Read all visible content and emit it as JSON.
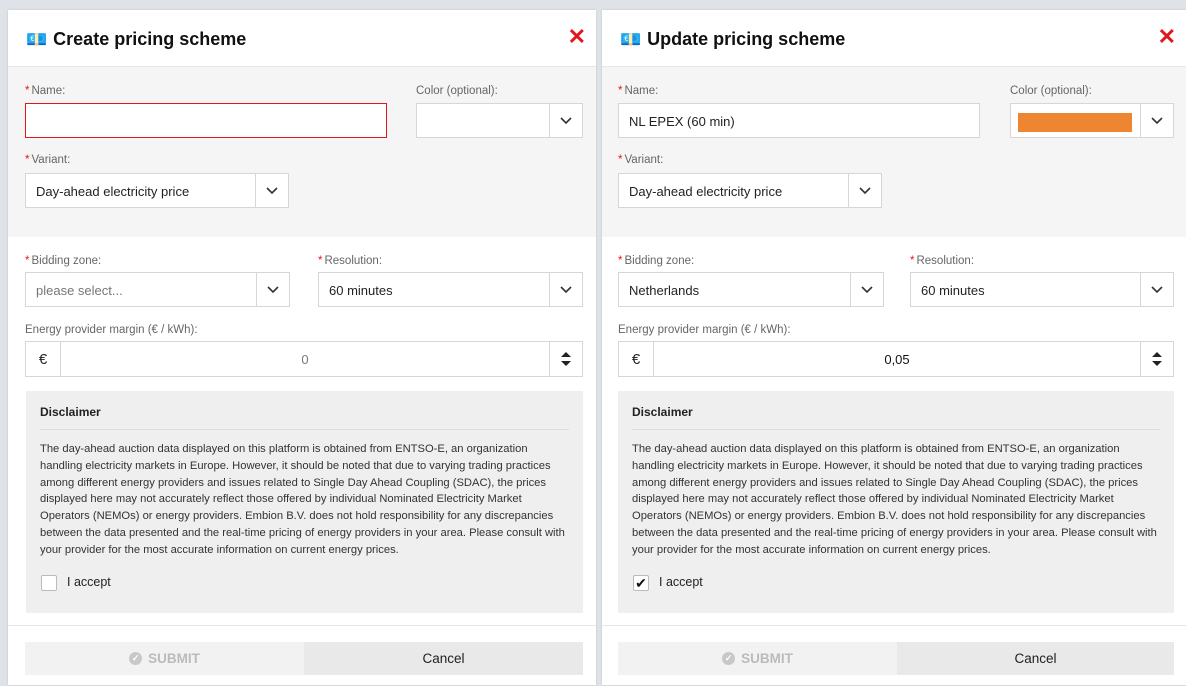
{
  "create": {
    "title": "Create pricing scheme",
    "title_icon": "money-icon",
    "name_label": "Name:",
    "name_value": "",
    "color_label": "Color (optional):",
    "variant_label": "Variant:",
    "variant_value": "Day-ahead electricity price",
    "bidding_label": "Bidding zone:",
    "bidding_value": "please select...",
    "resolution_label": "Resolution:",
    "resolution_value": "60 minutes",
    "margin_label": "Energy provider margin (€ / kWh):",
    "currency_symbol": "€",
    "margin_value": "0",
    "disclaimer_title": "Disclaimer",
    "disclaimer_text": "The day-ahead auction data displayed on this platform is obtained from ENTSO-E, an organization handling electricity markets in Europe. However, it should be noted that due to varying trading practices among different energy providers and issues related to Single Day Ahead Coupling (SDAC), the prices displayed here may not accurately reflect those offered by individual Nominated Electricity Market Operators (NEMOs) or energy providers. Embion B.V. does not hold responsibility for any discrepancies between the data presented and the real-time pricing of energy providers in your area. Please consult with your provider for the most accurate information on current energy prices.",
    "accept_label": "I accept",
    "accept_checked": false,
    "submit_label": "SUBMIT",
    "cancel_label": "Cancel"
  },
  "update": {
    "title": "Update pricing scheme",
    "title_icon": "money-icon",
    "name_label": "Name:",
    "name_value": "NL EPEX (60 min)",
    "color_label": "Color (optional):",
    "color_value": "#ee8631",
    "variant_label": "Variant:",
    "variant_value": "Day-ahead electricity price",
    "bidding_label": "Bidding zone:",
    "bidding_value": "Netherlands",
    "resolution_label": "Resolution:",
    "resolution_value": "60 minutes",
    "margin_label": "Energy provider margin (€ / kWh):",
    "currency_symbol": "€",
    "margin_value": "0,05",
    "disclaimer_title": "Disclaimer",
    "disclaimer_text": "The day-ahead auction data displayed on this platform is obtained from ENTSO-E, an organization handling electricity markets in Europe. However, it should be noted that due to varying trading practices among different energy providers and issues related to Single Day Ahead Coupling (SDAC), the prices displayed here may not accurately reflect those offered by individual Nominated Electricity Market Operators (NEMOs) or energy providers. Embion B.V. does not hold responsibility for any discrepancies between the data presented and the real-time pricing of energy providers in your area. Please consult with your provider for the most accurate information on current energy prices.",
    "accept_label": "I accept",
    "accept_checked": true,
    "submit_label": "SUBMIT",
    "cancel_label": "Cancel"
  },
  "colors": {
    "required_star": "#e3161d",
    "close_icon": "#e3161d",
    "error_border": "#e3161d",
    "swatch": "#ee8631"
  }
}
